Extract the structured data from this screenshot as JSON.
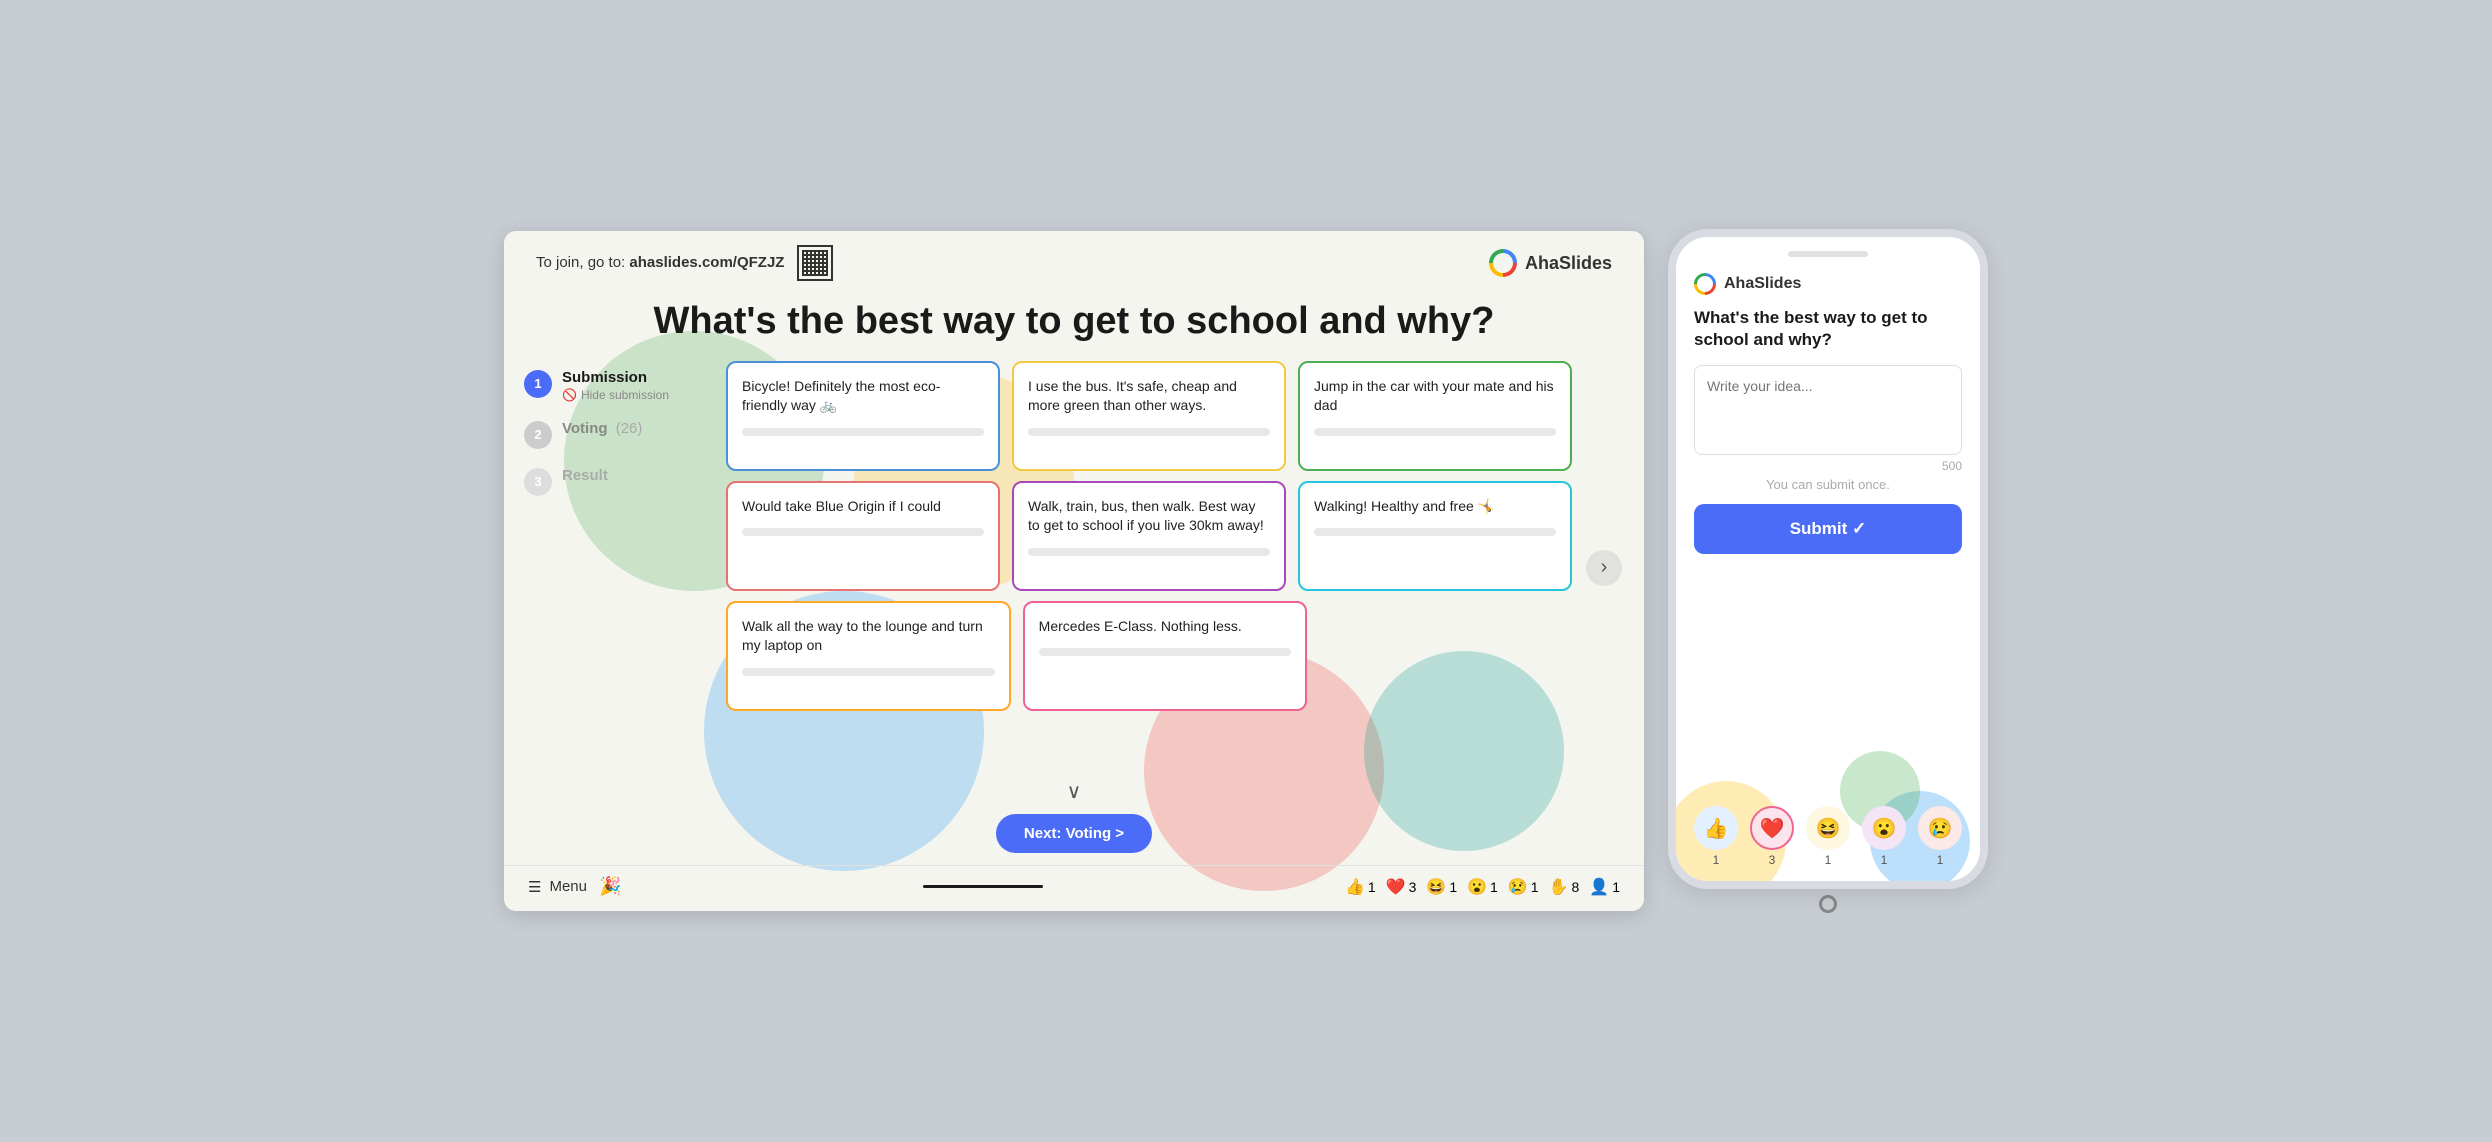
{
  "slide": {
    "join_text": "To join, go to:",
    "join_url": "ahaslides.com/QFZJZ",
    "brand": "AhaSlides",
    "title": "What's the best way to get to school and why?",
    "steps": [
      {
        "num": "1",
        "label": "Submission",
        "active": true,
        "sub": "Hide submission"
      },
      {
        "num": "2",
        "label": "Voting",
        "count": "(26)",
        "active": false
      },
      {
        "num": "3",
        "label": "Result",
        "active": false
      }
    ],
    "cards": [
      {
        "text": "Bicycle! Definitely the most eco-friendly way 🚲",
        "color": "blue"
      },
      {
        "text": "I use the bus. It's safe, cheap and more green than other ways.",
        "color": "yellow"
      },
      {
        "text": "Jump in the car with your mate and his dad",
        "color": "green"
      },
      {
        "text": "Would take Blue Origin if I could",
        "color": "red"
      },
      {
        "text": "Walk, train, bus, then walk. Best way to get to school if you live 30km away!",
        "color": "purple"
      },
      {
        "text": "Walking! Healthy and free 🤸",
        "color": "teal"
      },
      {
        "text": "Walk all the way to the lounge and turn my laptop on",
        "color": "orange"
      },
      {
        "text": "Mercedes E-Class. Nothing less.",
        "color": "pink"
      }
    ],
    "down_arrow": "∨",
    "next_btn": "Next: Voting >",
    "menu_label": "Menu",
    "reactions": [
      {
        "emoji": "👍",
        "count": "1"
      },
      {
        "emoji": "❤️",
        "count": "3"
      },
      {
        "emoji": "😆",
        "count": "1"
      },
      {
        "emoji": "😮",
        "count": "1"
      },
      {
        "emoji": "😢",
        "count": "1"
      },
      {
        "emoji": "✋",
        "count": "8"
      },
      {
        "emoji": "👤",
        "count": "1"
      }
    ]
  },
  "phone": {
    "brand": "AhaSlides",
    "question": "What's the best way to get to school and why?",
    "textarea_placeholder": "Write your idea...",
    "char_count": "500",
    "submit_note": "You can submit once.",
    "submit_btn": "Submit ✓",
    "reactions": [
      {
        "emoji": "👍",
        "count": "1",
        "style": "rb-blue"
      },
      {
        "emoji": "❤️",
        "count": "3",
        "style": "rb-pink"
      },
      {
        "emoji": "😆",
        "count": "1",
        "style": "rb-laugh"
      },
      {
        "emoji": "😮",
        "count": "1",
        "style": "rb-wow"
      },
      {
        "emoji": "😢",
        "count": "1",
        "style": "rb-sad"
      }
    ]
  }
}
